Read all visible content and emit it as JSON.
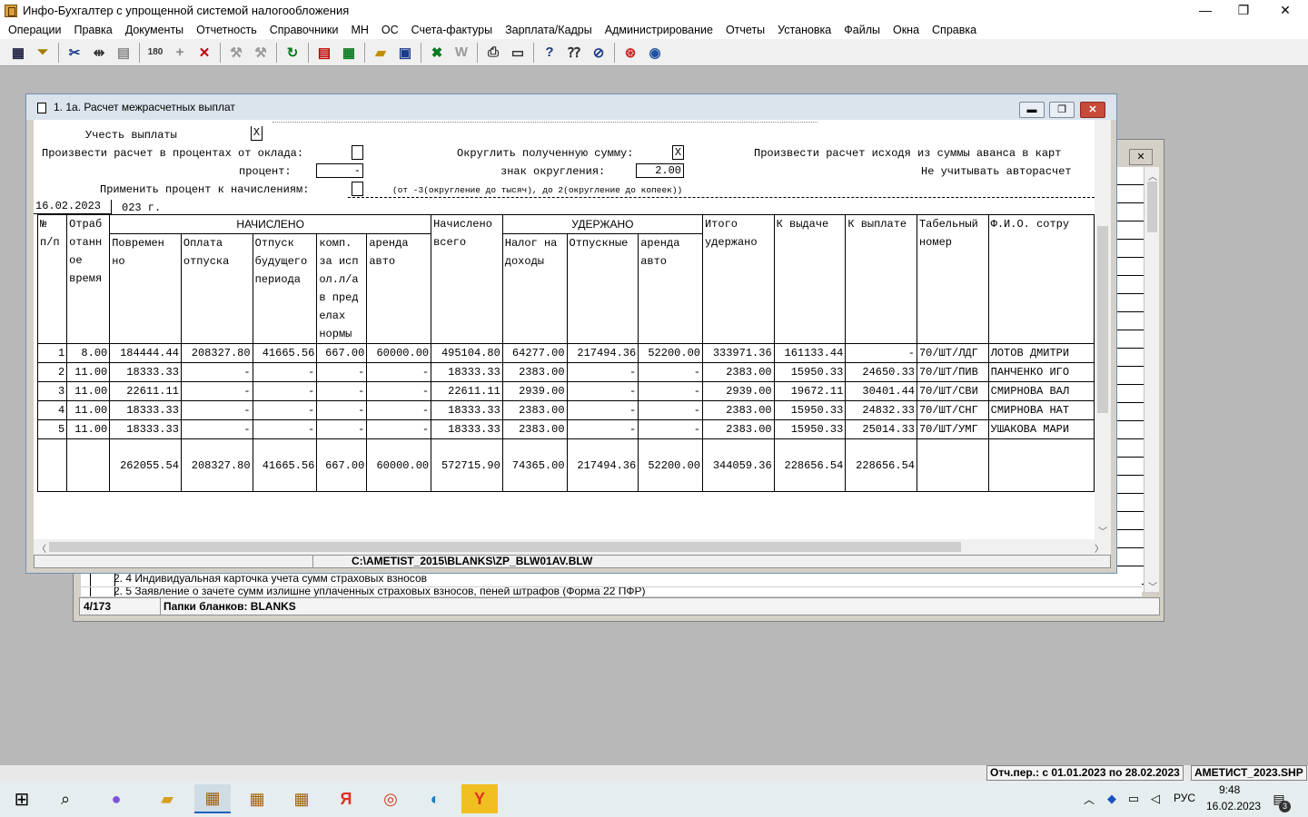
{
  "app": {
    "title": "Инфо-Бухгалтер с упрощенной системой налогообложения",
    "minimize": "—",
    "maximize": "❐",
    "close": "✕"
  },
  "menu": [
    "Операции",
    "Правка",
    "Документы",
    "Отчетность",
    "Справочники",
    "МН",
    "ОС",
    "Счета-фактуры",
    "Зарплата/Кадры",
    "Администрирование",
    "Отчеты",
    "Установка",
    "Файлы",
    "Окна",
    "Справка"
  ],
  "toolbar": [
    "grid-icon",
    "filter-icon",
    "cut-icon",
    "move-icon",
    "paste-icon",
    "calc-icon",
    "add-icon",
    "delete-icon",
    "tool-icon",
    "tool2-icon",
    "refresh-icon",
    "pdf-icon",
    "table-icon",
    "open-folder-icon",
    "save-icon",
    "excel-icon",
    "word-icon",
    "print-icon",
    "preview-icon",
    "help-icon",
    "whats-this-icon",
    "compass-icon",
    "lifebuoy-icon",
    "globe-icon"
  ],
  "bg_window": {
    "item1": "2. 4 Индивидуальная карточка учета сумм страховых взносов",
    "item2": "2. 5  Заявление о зачете сумм излишне уплаченных страховых взносов, пеней штрафов (Форма 22 ПФР)",
    "counter": "4/173",
    "folder_label": "Папки бланков: BLANKS",
    "close": "✕"
  },
  "window": {
    "title": "1. 1а. Расчет межрасчетных выплат",
    "pay_label": "Учесть выплаты",
    "pay_value": "X",
    "pct_salary_label": "Произвести расчет в процентах от оклада:",
    "pct_salary_value": "",
    "percent_label": "процент:",
    "percent_value": "-",
    "apply_pct_label": "Применить процент к начислениям:",
    "apply_pct_value": "",
    "round_label": "Округлить полученную сумму:",
    "round_value": "X",
    "round_sign_label": "знак округления:",
    "round_sign_value": "2.00",
    "round_hint": "(от -3(округление до тысяч), до 2(округление до копеек))",
    "advance_label": "Произвести расчет исходя из суммы аванса в карт",
    "autocalc_label": "Не учитывать авторасчет",
    "date_value": "16.02.2023",
    "date_suffix": "023 г.",
    "path": "C:\\AMETIST_2015\\BLANKS\\ZP_BLW01AV.BLW"
  },
  "table": {
    "h_no": "№",
    "h_no2": "п/п",
    "h_hours": [
      "Отраб",
      "отанн",
      "ое",
      "время"
    ],
    "h_accrued": "НАЧИСЛЕНО",
    "h_total_accrued": [
      "Начислено",
      "всего"
    ],
    "h_withheld": "УДЕРЖАНО",
    "h_total_withheld": [
      "Итого",
      "удержано"
    ],
    "h_to_issue": "К выдаче",
    "h_to_pay": "К выплате",
    "h_tab": [
      "Табельный",
      "номер"
    ],
    "h_fio": "Ф.И.О. сотру",
    "sub_accrued": [
      [
        "Повремен",
        "но"
      ],
      [
        "Оплата",
        "отпуска"
      ],
      [
        "Отпуск",
        "будущего",
        "периода"
      ],
      [
        "комп.",
        "за исп",
        "ол.л/а",
        "в пред",
        "елах",
        "нормы"
      ],
      [
        "аренда",
        "авто"
      ]
    ],
    "sub_withheld": [
      [
        "Налог на",
        "доходы"
      ],
      [
        "Отпускные"
      ],
      [
        "аренда",
        "авто"
      ]
    ],
    "rows": [
      [
        "1",
        "8.00",
        "184444.44",
        "208327.80",
        "41665.56",
        "667.00",
        "60000.00",
        "495104.80",
        "64277.00",
        "217494.36",
        "52200.00",
        "333971.36",
        "161133.44",
        "-",
        "70/ШТ/ЛДГ",
        "ЛОТОВ ДМИТРИ"
      ],
      [
        "2",
        "11.00",
        "18333.33",
        "-",
        "-",
        "-",
        "-",
        "18333.33",
        "2383.00",
        "-",
        "-",
        "2383.00",
        "15950.33",
        "24650.33",
        "70/ШТ/ПИВ",
        "ПАНЧЕНКО ИГО"
      ],
      [
        "3",
        "11.00",
        "22611.11",
        "-",
        "-",
        "-",
        "-",
        "22611.11",
        "2939.00",
        "-",
        "-",
        "2939.00",
        "19672.11",
        "30401.44",
        "70/ШТ/СВИ",
        "СМИРНОВА ВАЛ"
      ],
      [
        "4",
        "11.00",
        "18333.33",
        "-",
        "-",
        "-",
        "-",
        "18333.33",
        "2383.00",
        "-",
        "-",
        "2383.00",
        "15950.33",
        "24832.33",
        "70/ШТ/СНГ",
        "СМИРНОВА НАТ"
      ],
      [
        "5",
        "11.00",
        "18333.33",
        "-",
        "-",
        "-",
        "-",
        "18333.33",
        "2383.00",
        "-",
        "-",
        "2383.00",
        "15950.33",
        "25014.33",
        "70/ШТ/УМГ",
        "УШАКОВА МАРИ"
      ]
    ],
    "totals": [
      "262055.54",
      "208327.80",
      "41665.56",
      "667.00",
      "60000.00",
      "572715.90",
      "74365.00",
      "217494.36",
      "52200.00",
      "344059.36",
      "228656.54",
      "228656.54"
    ]
  },
  "status": {
    "period": "Отч.пер.: с 01.01.2023 по 28.02.2023",
    "file": "АМЕТИСТ_2023.SHP"
  },
  "taskbar": {
    "lang": "РУС",
    "time": "9:48",
    "date": "16.02.2023",
    "notif": "3"
  },
  "colors": {
    "mdi_bg": "#b8b8b8",
    "win_bg": "#d4d0c8",
    "close_red": "#c84a3a"
  }
}
